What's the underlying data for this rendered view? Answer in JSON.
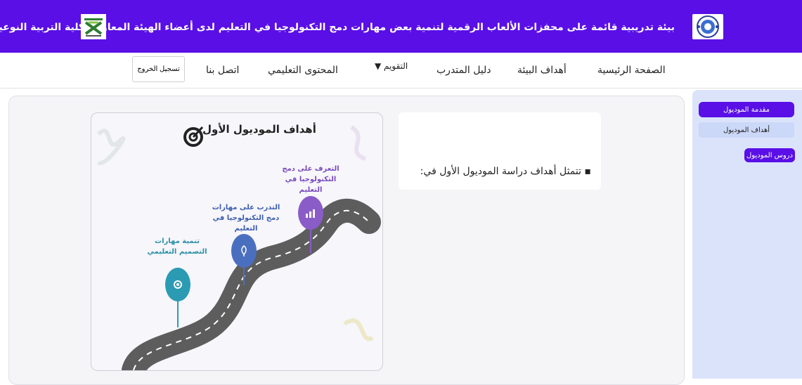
{
  "header": {
    "title": "بيئة تدريبية قائمة على محفزات الألعاب الرقمية لتنمية بعض مهارات دمج التكنولوجيا في التعليم لدى أعضاء الهيئة المعاونة بكلية التربية النوعية",
    "bg_color": "#5a0fe6"
  },
  "nav": {
    "items": [
      "الصفحة الرئيسية",
      "أهداف البيئة",
      "دليل المتدرب",
      "التقويم ▼",
      "المحتوى التعليمي",
      "اتصل بنا"
    ],
    "logout_label": "تسجيل الخروج"
  },
  "sidebar": {
    "items": [
      "مقدمة الموديول",
      "أهداف الموديول",
      "دروس الموديول"
    ],
    "active_color": "#5a0fe6"
  },
  "content": {
    "bullet_text": "تتمثل أهداف دراسة الموديول الأول في:"
  },
  "infographic": {
    "title": "أهداف الموديول الأول",
    "goals": [
      {
        "label": "التعرف على دمج التكنولوجيا في التعليم",
        "color": "#8a5cc8",
        "icon": "chart-icon"
      },
      {
        "label": "التدرب على مهارات دمج التكنولوجيا في التعليم",
        "color": "#4b6fbf",
        "icon": "rocket-icon"
      },
      {
        "label": "تنمية مهارات التصميم التعليمي",
        "color": "#2b9bb3",
        "icon": "gear-icon"
      }
    ]
  }
}
